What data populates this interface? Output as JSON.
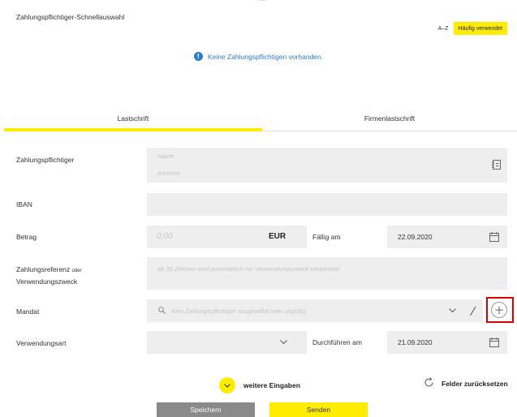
{
  "quick_select": {
    "title": "Zahlungspflichtiger-Schnellauswahl",
    "sort_az": "A–Z",
    "sort_frequent": "Häufig verwendet"
  },
  "info": {
    "icon": "exclamation-icon",
    "message": "Keine Zahlungspflichtigen vorhanden."
  },
  "tabs": [
    {
      "label": "Lastschrift",
      "active": true
    },
    {
      "label": "Firmenlastschrift",
      "active": false
    }
  ],
  "form": {
    "payer": {
      "label": "Zahlungspflichtiger",
      "name_placeholder": "Name",
      "address_placeholder": "Adresse"
    },
    "iban": {
      "label": "IBAN",
      "value": ""
    },
    "amount": {
      "label": "Betrag",
      "placeholder": "0,00",
      "currency": "EUR",
      "due_label": "Fällig am",
      "due_date": "22.09.2020"
    },
    "reference": {
      "label_line1": "Zahlungsreferenz",
      "label_oder": "oder",
      "label_line2": "Verwendungszweck",
      "placeholder": "ab 36 Zeichen wird automatisch ein Verwendungszweck verarbeitet"
    },
    "mandate": {
      "label": "Mandat",
      "placeholder": "Kein Zahlungspflichtiger ausgewählt oder ungültig"
    },
    "purpose_type": {
      "label": "Verwendungsart",
      "value": "",
      "execute_label": "Durchführen am",
      "execute_date": "21.09.2020"
    }
  },
  "actions": {
    "more_inputs": "weitere Eingaben",
    "reset_fields": "Felder zurücksetzen",
    "save": "Speichern",
    "send": "Senden"
  },
  "colors": {
    "accent": "#ffed00",
    "info": "#2b7bd0",
    "highlight": "#d80000",
    "field_bg": "#eeeeee"
  }
}
